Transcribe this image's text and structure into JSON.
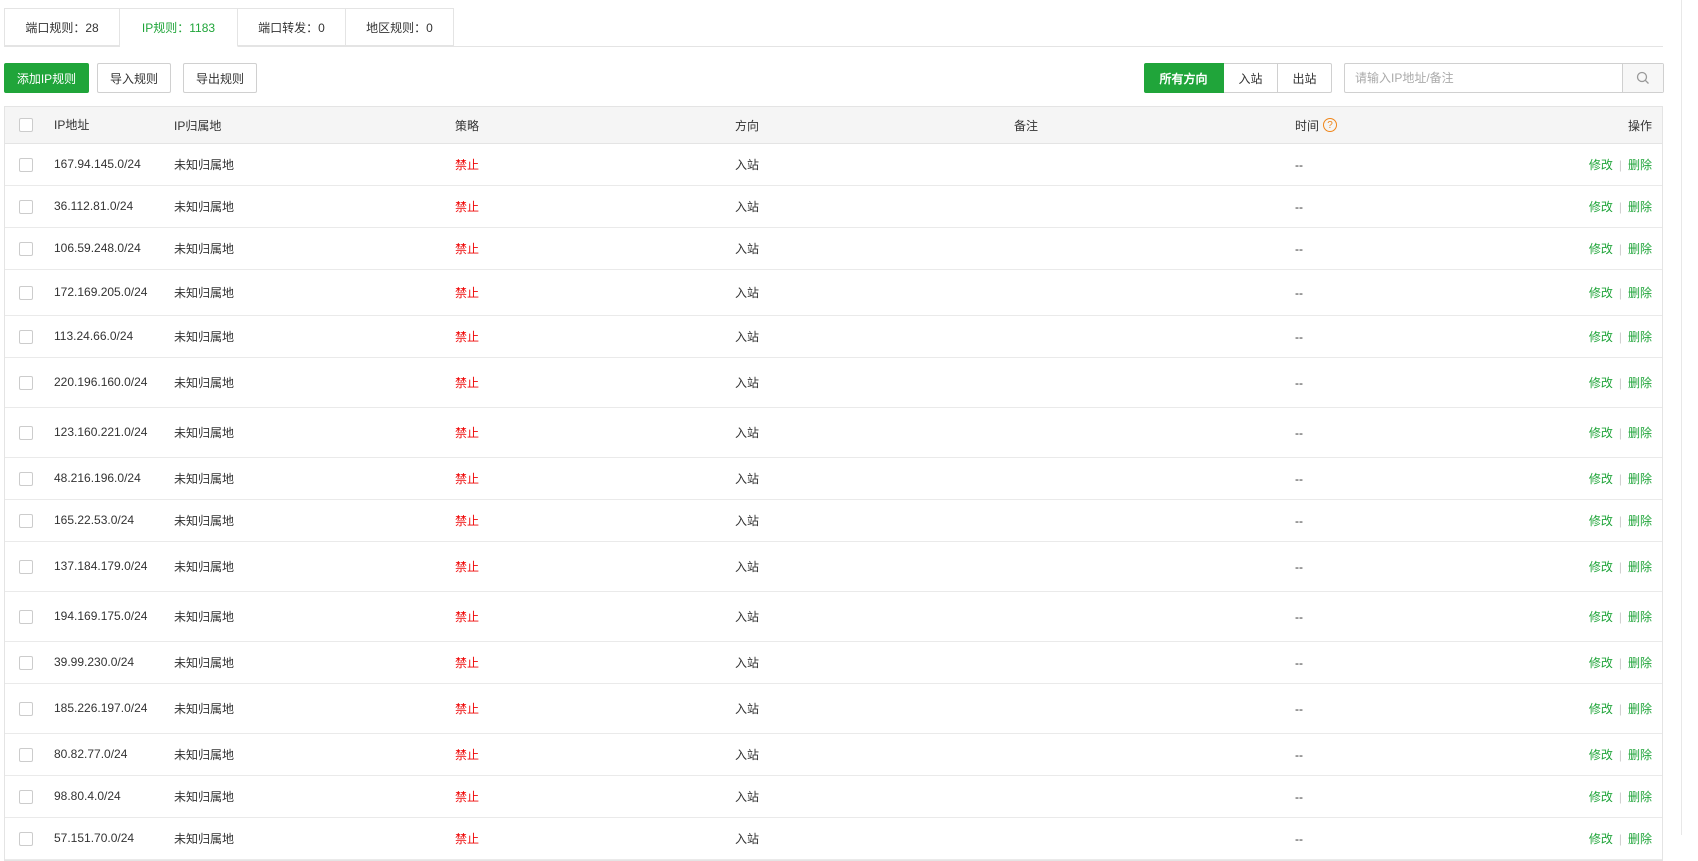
{
  "tabs": [
    {
      "label": "端口规则：28"
    },
    {
      "label": "IP规则：1183"
    },
    {
      "label": "端口转发：0"
    },
    {
      "label": "地区规则：0"
    }
  ],
  "toolbar": {
    "add_label": "添加IP规则",
    "import_label": "导入规则",
    "export_label": "导出规则",
    "direction_all": "所有方向",
    "direction_in": "入站",
    "direction_out": "出站",
    "search_placeholder": "请输入IP地址/备注"
  },
  "table": {
    "headers": {
      "ip": "IP地址",
      "location": "IP归属地",
      "policy": "策略",
      "direction": "方向",
      "remark": "备注",
      "time": "时间",
      "ops": "操作"
    },
    "edit_label": "修改",
    "delete_label": "删除",
    "rows": [
      {
        "ip": "167.94.145.0/24",
        "location": "未知归属地",
        "policy": "禁止",
        "direction": "入站",
        "time": "--"
      },
      {
        "ip": "36.112.81.0/24",
        "location": "未知归属地",
        "policy": "禁止",
        "direction": "入站",
        "time": "--"
      },
      {
        "ip": "106.59.248.0/24",
        "location": "未知归属地",
        "policy": "禁止",
        "direction": "入站",
        "time": "--"
      },
      {
        "ip": "172.169.205.0/24",
        "location": "未知归属地",
        "policy": "禁止",
        "direction": "入站",
        "time": "--"
      },
      {
        "ip": "113.24.66.0/24",
        "location": "未知归属地",
        "policy": "禁止",
        "direction": "入站",
        "time": "--"
      },
      {
        "ip": "220.196.160.0/24",
        "location": "未知归属地",
        "policy": "禁止",
        "direction": "入站",
        "time": "--"
      },
      {
        "ip": "123.160.221.0/24",
        "location": "未知归属地",
        "policy": "禁止",
        "direction": "入站",
        "time": "--"
      },
      {
        "ip": "48.216.196.0/24",
        "location": "未知归属地",
        "policy": "禁止",
        "direction": "入站",
        "time": "--"
      },
      {
        "ip": "165.22.53.0/24",
        "location": "未知归属地",
        "policy": "禁止",
        "direction": "入站",
        "time": "--"
      },
      {
        "ip": "137.184.179.0/24",
        "location": "未知归属地",
        "policy": "禁止",
        "direction": "入站",
        "time": "--"
      },
      {
        "ip": "194.169.175.0/24",
        "location": "未知归属地",
        "policy": "禁止",
        "direction": "入站",
        "time": "--"
      },
      {
        "ip": "39.99.230.0/24",
        "location": "未知归属地",
        "policy": "禁止",
        "direction": "入站",
        "time": "--"
      },
      {
        "ip": "185.226.197.0/24",
        "location": "未知归属地",
        "policy": "禁止",
        "direction": "入站",
        "time": "--"
      },
      {
        "ip": "80.82.77.0/24",
        "location": "未知归属地",
        "policy": "禁止",
        "direction": "入站",
        "time": "--"
      },
      {
        "ip": "98.80.4.0/24",
        "location": "未知归属地",
        "policy": "禁止",
        "direction": "入站",
        "time": "--"
      },
      {
        "ip": "57.151.70.0/24",
        "location": "未知归属地",
        "policy": "禁止",
        "direction": "入站",
        "time": "--"
      }
    ]
  }
}
